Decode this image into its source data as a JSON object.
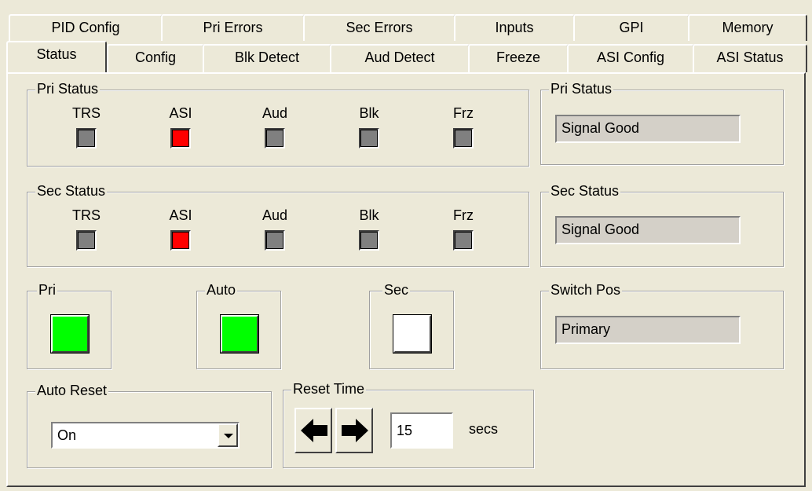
{
  "tabs_row1": [
    "PID Config",
    "Pri Errors",
    "Sec Errors",
    "Inputs",
    "GPI",
    "Memory"
  ],
  "tabs_row2": [
    "Status",
    "Config",
    "Blk Detect",
    "Aud Detect",
    "Freeze",
    "ASI Config",
    "ASI Status"
  ],
  "active_tab": "Status",
  "pri_status_group": {
    "title": "Pri Status",
    "indicators": [
      {
        "label": "TRS",
        "state": "gray"
      },
      {
        "label": "ASI",
        "state": "red"
      },
      {
        "label": "Aud",
        "state": "gray"
      },
      {
        "label": "Blk",
        "state": "gray"
      },
      {
        "label": "Frz",
        "state": "gray"
      }
    ]
  },
  "sec_status_group": {
    "title": "Sec Status",
    "indicators": [
      {
        "label": "TRS",
        "state": "gray"
      },
      {
        "label": "ASI",
        "state": "red"
      },
      {
        "label": "Aud",
        "state": "gray"
      },
      {
        "label": "Blk",
        "state": "gray"
      },
      {
        "label": "Frz",
        "state": "gray"
      }
    ]
  },
  "pri_status_box": {
    "title": "Pri Status",
    "value": "Signal Good"
  },
  "sec_status_box": {
    "title": "Sec Status",
    "value": "Signal Good"
  },
  "switch_pos_box": {
    "title": "Switch Pos",
    "value": "Primary"
  },
  "pri_button": {
    "title": "Pri",
    "state": "green"
  },
  "auto_button": {
    "title": "Auto",
    "state": "green"
  },
  "sec_button": {
    "title": "Sec",
    "state": "white"
  },
  "auto_reset": {
    "title": "Auto Reset",
    "value": "On"
  },
  "reset_time": {
    "title": "Reset Time",
    "value": "15",
    "unit": "secs"
  },
  "colors": {
    "led_gray": "#808080",
    "led_red": "#ff0000",
    "btn_green": "#00ff00",
    "btn_white": "#ffffff",
    "background": "#ece9d8"
  },
  "icons": {
    "left_arrow": "arrow-left-icon",
    "right_arrow": "arrow-right-icon",
    "dropdown": "chevron-down-icon"
  }
}
